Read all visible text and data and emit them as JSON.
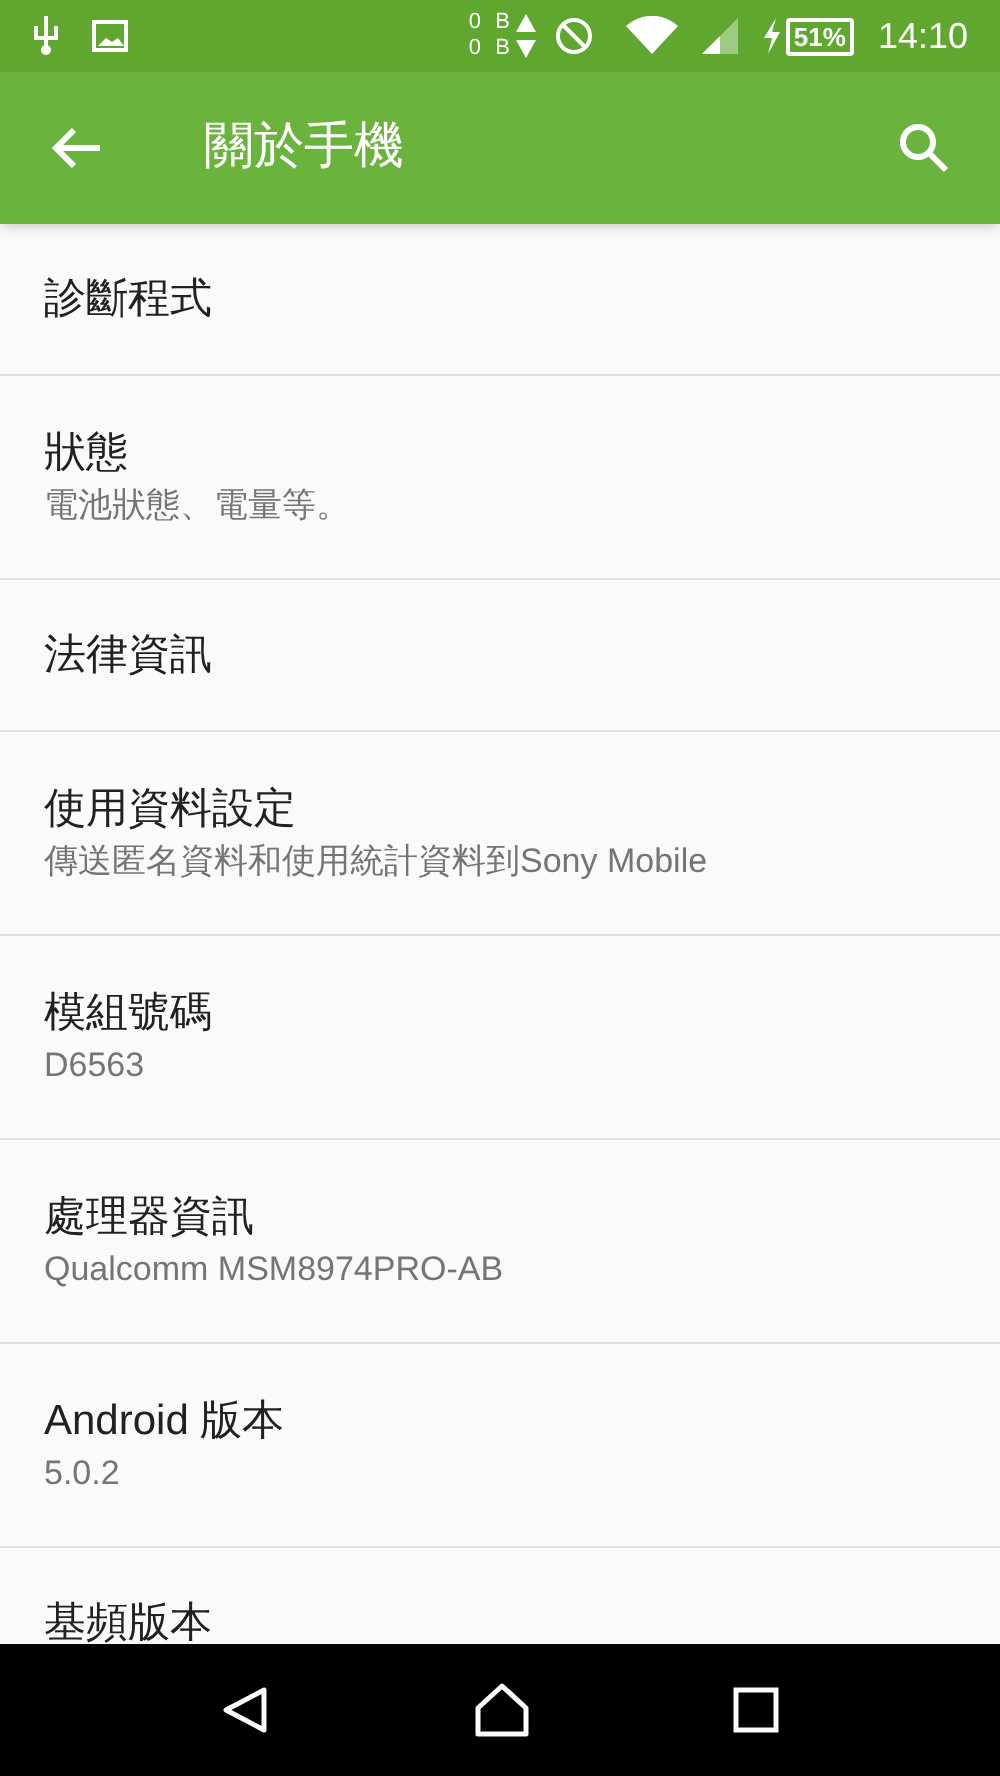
{
  "status_bar": {
    "data_up": "0 B",
    "data_down": "0 B",
    "battery": "51%",
    "time": "14:10"
  },
  "app_bar": {
    "title": "關於手機"
  },
  "items": [
    {
      "title": "診斷程式"
    },
    {
      "title": "狀態",
      "summary": "電池狀態、電量等。"
    },
    {
      "title": "法律資訊"
    },
    {
      "title": "使用資料設定",
      "summary": "傳送匿名資料和使用統計資料到Sony Mobile"
    },
    {
      "title": "模組號碼",
      "summary": "D6563"
    },
    {
      "title": "處理器資訊",
      "summary": "Qualcomm MSM8974PRO-AB"
    },
    {
      "title": "Android 版本",
      "summary": "5.0.2"
    },
    {
      "title": "基頻版本"
    }
  ]
}
